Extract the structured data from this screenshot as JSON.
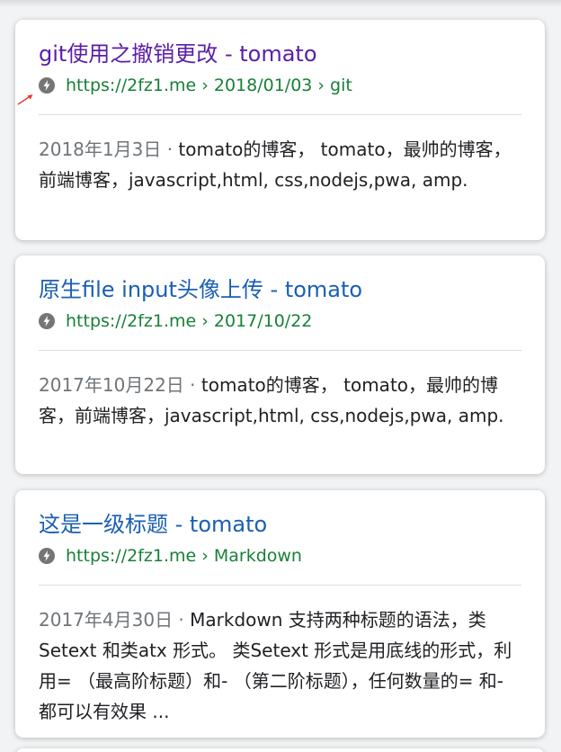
{
  "colors": {
    "visited_link": "#5a1ea8",
    "link": "#1a5fb4",
    "url_green": "#188038",
    "snippet_text": "#202124",
    "date_gray": "#70757a"
  },
  "results": [
    {
      "title": "git使用之撤销更改 - tomato",
      "url": "https://2fz1.me › 2018/01/03 › git",
      "date": "2018年1月3日 · ",
      "snippet": "tomato的博客， tomato，最帅的博客，前端博客，javascript,html, css,nodejs,pwa, amp.",
      "visited": true,
      "icon": "amp-lightning-icon"
    },
    {
      "title": "原生file input头像上传 - tomato",
      "url": "https://2fz1.me › 2017/10/22",
      "date": "2017年10月22日 · ",
      "snippet": "tomato的博客， tomato，最帅的博客，前端博客，javascript,html, css,nodejs,pwa, amp.",
      "visited": false,
      "icon": "amp-lightning-icon"
    },
    {
      "title": "这是一级标题 - tomato",
      "url": "https://2fz1.me › Markdown",
      "date": "2017年4月30日 · ",
      "snippet": "Markdown 支持两种标题的语法，类Setext 和类atx 形式。 类Setext 形式是用底线的形式，利用= （最高阶标题）和- （第二阶标题），任何数量的= 和- 都可以有效果 ...",
      "visited": false,
      "icon": "amp-lightning-icon"
    }
  ]
}
